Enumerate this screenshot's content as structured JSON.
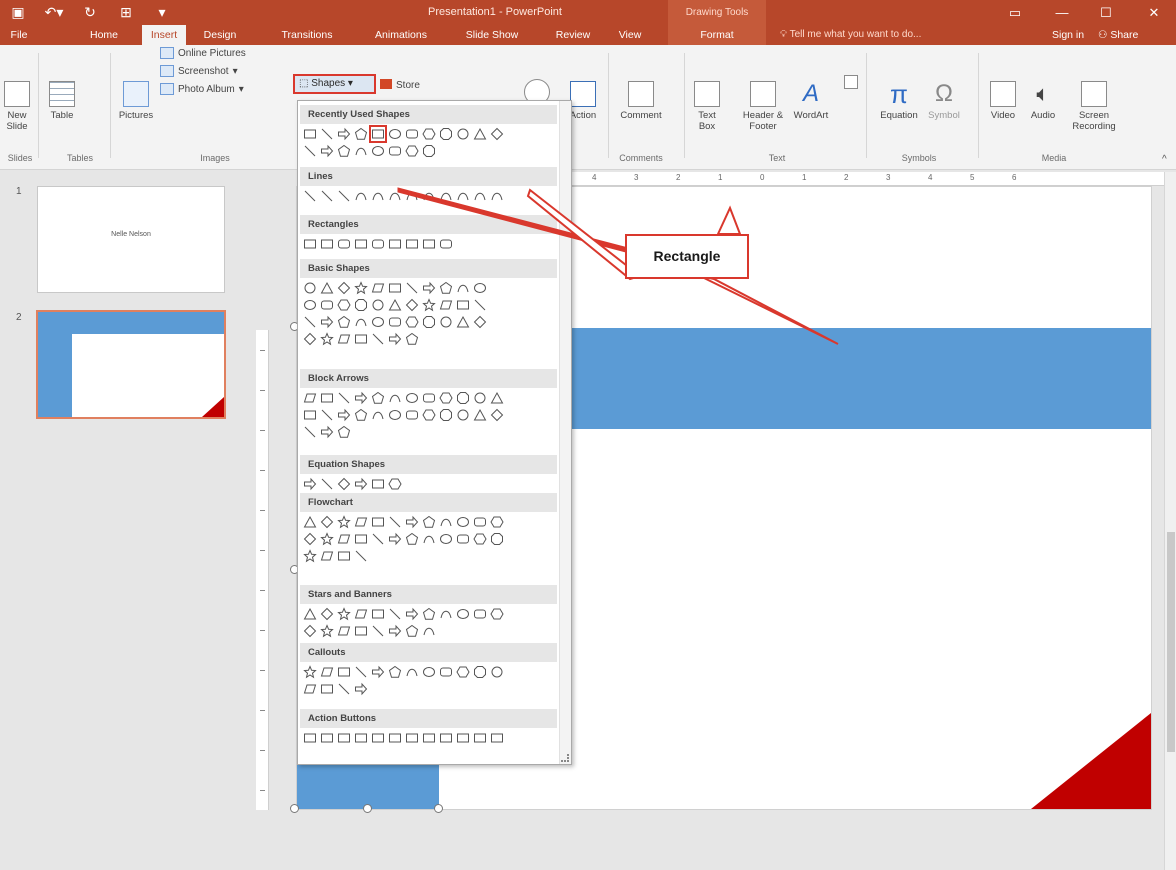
{
  "window": {
    "title": "Presentation1 - PowerPoint",
    "contextual_group": "Drawing Tools"
  },
  "quick_access": [
    "save-icon",
    "undo-icon",
    "redo-icon",
    "start-from-beginning-icon",
    "customize-icon"
  ],
  "tabs": [
    "File",
    "Home",
    "Insert",
    "Design",
    "Transitions",
    "Animations",
    "Slide Show",
    "Review",
    "View",
    "Format"
  ],
  "active_tab": "Insert",
  "tell_me": "Tell me what you want to do...",
  "account": {
    "sign_in": "Sign in",
    "share": "Share"
  },
  "ribbon": {
    "new_slide": "New Slide",
    "table": "Table",
    "pictures": "Pictures",
    "online_pictures": "Online Pictures",
    "screenshot": "Screenshot",
    "photo_album": "Photo Album",
    "shapes": "Shapes",
    "store": "Store",
    "action": "Action",
    "comment": "Comment",
    "text_box": "Text Box",
    "header_footer": "Header & Footer",
    "wordart": "WordArt",
    "equation": "Equation",
    "symbol": "Symbol",
    "video": "Video",
    "audio": "Audio",
    "screen_recording": "Screen Recording",
    "groups": {
      "slides": "Slides",
      "tables": "Tables",
      "images": "Images",
      "comments": "Comments",
      "text": "Text",
      "symbols": "Symbols",
      "media": "Media"
    }
  },
  "gallery": {
    "sections": [
      "Recently Used Shapes",
      "Lines",
      "Rectangles",
      "Basic Shapes",
      "Block Arrows",
      "Equation Shapes",
      "Flowchart",
      "Stars and Banners",
      "Callouts",
      "Action Buttons"
    ]
  },
  "callout": {
    "label": "Rectangle"
  },
  "ruler": [
    "6",
    "5",
    "4",
    "3",
    "2",
    "1",
    "0",
    "1",
    "2",
    "3",
    "4",
    "5",
    "6"
  ],
  "slides": [
    {
      "number": "1",
      "title": "Nelle Nelson"
    },
    {
      "number": "2"
    }
  ],
  "colors": {
    "accent": "#b7472a",
    "slide_blue": "#5b9bd5",
    "slide_red": "#c00000",
    "highlight": "#d9382d"
  }
}
